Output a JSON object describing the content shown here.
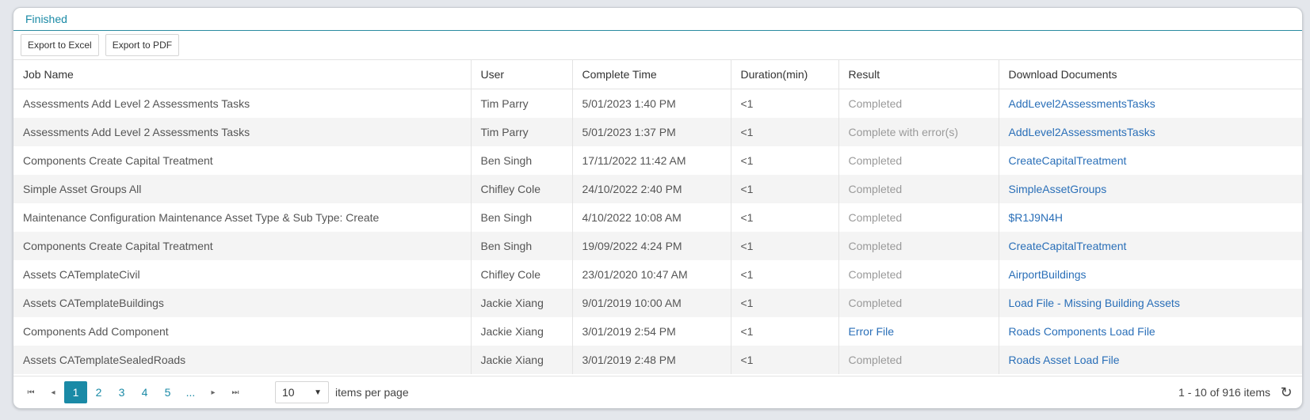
{
  "panel": {
    "title": "Finished"
  },
  "toolbar": {
    "export_excel": "Export to Excel",
    "export_pdf": "Export to PDF"
  },
  "table": {
    "columns": [
      "Job Name",
      "User",
      "Complete Time",
      "Duration(min)",
      "Result",
      "Download Documents"
    ],
    "rows": [
      [
        "Assessments Add Level 2 Assessments Tasks",
        "Tim Parry",
        "5/01/2023 1:40 PM",
        "<1",
        "Completed",
        "AddLevel2AssessmentsTasks"
      ],
      [
        "Assessments Add Level 2 Assessments Tasks",
        "Tim Parry",
        "5/01/2023 1:37 PM",
        "<1",
        "Complete with error(s)",
        "AddLevel2AssessmentsTasks"
      ],
      [
        "Components Create Capital Treatment",
        "Ben Singh",
        "17/11/2022 11:42 AM",
        "<1",
        "Completed",
        "CreateCapitalTreatment"
      ],
      [
        "Simple Asset Groups All",
        "Chifley Cole",
        "24/10/2022 2:40 PM",
        "<1",
        "Completed",
        "SimpleAssetGroups"
      ],
      [
        "Maintenance Configuration Maintenance Asset Type & Sub Type: Create",
        "Ben Singh",
        "4/10/2022 10:08 AM",
        "<1",
        "Completed",
        "$R1J9N4H"
      ],
      [
        "Components Create Capital Treatment",
        "Ben Singh",
        "19/09/2022 4:24 PM",
        "<1",
        "Completed",
        "CreateCapitalTreatment"
      ],
      [
        "Assets CATemplateCivil",
        "Chifley Cole",
        "23/01/2020 10:47 AM",
        "<1",
        "Completed",
        "AirportBuildings"
      ],
      [
        "Assets CATemplateBuildings",
        "Jackie Xiang",
        "9/01/2019 10:00 AM",
        "<1",
        "Completed",
        "Load File - Missing Building Assets"
      ],
      [
        "Components Add Component",
        "Jackie Xiang",
        "3/01/2019 2:54 PM",
        "<1",
        "Error File",
        "Roads Components Load File"
      ],
      [
        "Assets CATemplateSealedRoads",
        "Jackie Xiang",
        "3/01/2019 2:48 PM",
        "<1",
        "Completed",
        "Roads Asset Load File"
      ]
    ]
  },
  "pager": {
    "first_icon": "first-page-icon",
    "prev_icon": "prev-page-icon",
    "next_icon": "next-page-icon",
    "last_icon": "last-page-icon",
    "pages": [
      "1",
      "2",
      "3",
      "4",
      "5",
      "..."
    ],
    "current_page": "1",
    "page_size": "10",
    "items_per_page_label": "items per page",
    "info": "1 - 10 of 916 items",
    "refresh_icon": "refresh-icon"
  },
  "colors": {
    "accent": "#1a8aa6",
    "link": "#2a6fb8",
    "muted": "#9a9a9a"
  }
}
